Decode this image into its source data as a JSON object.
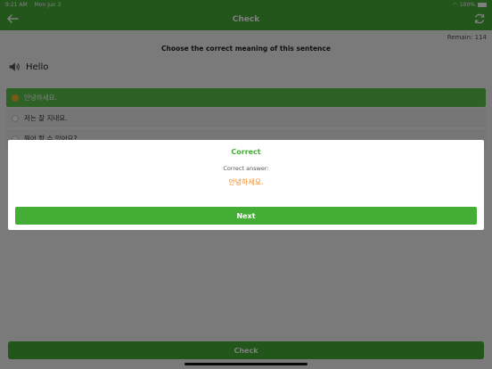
{
  "status_bar": {
    "time": "9:21 AM",
    "date": "Mon Jun 3",
    "battery": "100%"
  },
  "nav": {
    "title": "Check",
    "back_icon": "arrow-left-icon",
    "refresh_icon": "refresh-icon"
  },
  "remain": "Remain: 114",
  "instruction": "Choose the correct meaning of this sentence",
  "prompt": "Hello",
  "options": [
    {
      "label": "안녕하세요."
    },
    {
      "label": "저는 잘 지내요."
    },
    {
      "label": "뭐어 할 수 있어요?"
    }
  ],
  "dialog": {
    "title": "Correct",
    "label": "Correct answer:",
    "answer": "안녕하세요.",
    "next": "Next"
  },
  "bottom_button": "Check",
  "colors": {
    "accent": "#44ad36",
    "answer": "#f08a24"
  }
}
